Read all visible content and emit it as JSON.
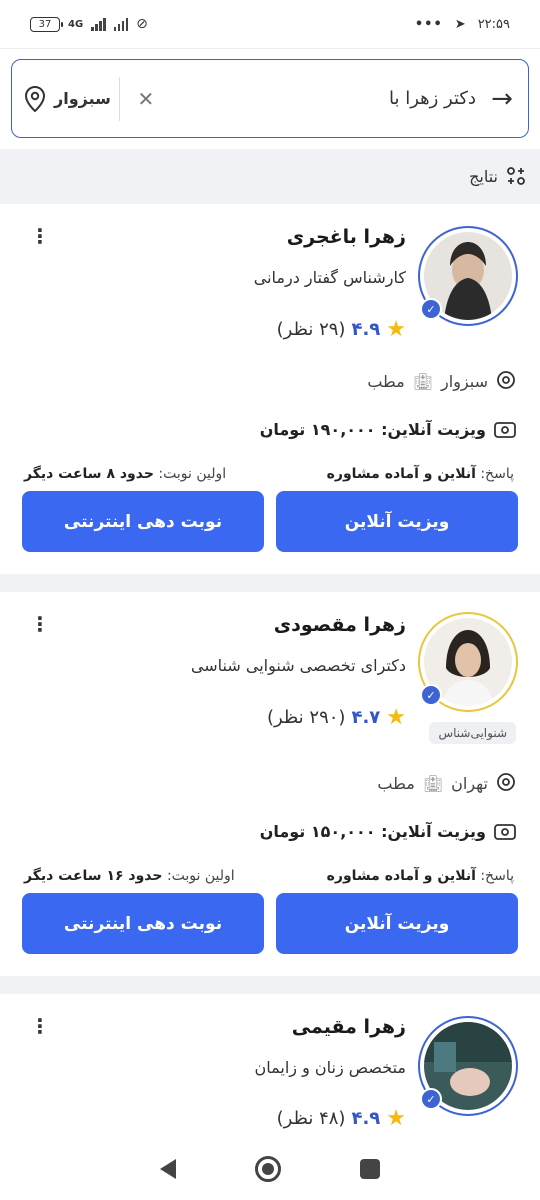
{
  "status": {
    "battery": "37",
    "network": "4G",
    "time": "۲۲:۵۹",
    "dots": "•••"
  },
  "search": {
    "query": "دکتر زهرا با",
    "city": "سبزوار"
  },
  "results": {
    "title": "نتایج"
  },
  "doctors": [
    {
      "name": "زهرا باغجری",
      "specialty": "کارشناس گفتار درمانی",
      "score": "۴.۹",
      "count": "(۲۹ نظر)",
      "tag": "",
      "city": "سبزوار",
      "office": "مطب",
      "visit": "ویزیت آنلاین: ۱۹۰,۰۰۰ تومان",
      "response_label": "پاسخ:",
      "response_value": "آنلاین و آماده مشاوره",
      "first_label": "اولین نوبت:",
      "first_value": "حدود ۸ ساعت دیگر",
      "btn_online": "ویزیت آنلاین",
      "btn_book": "نوبت دهی اینترنتی"
    },
    {
      "name": "زهرا مقصودی",
      "specialty": "دکترای تخصصی شنوایی شناسی",
      "score": "۴.۷",
      "count": "(۲۹۰ نظر)",
      "tag": "شنوایی‌شناس",
      "city": "تهران",
      "office": "مطب",
      "visit": "ویزیت آنلاین: ۱۵۰,۰۰۰ تومان",
      "response_label": "پاسخ:",
      "response_value": "آنلاین و آماده مشاوره",
      "first_label": "اولین نوبت:",
      "first_value": "حدود ۱۶ ساعت دیگر",
      "btn_online": "ویزیت آنلاین",
      "btn_book": "نوبت دهی اینترنتی"
    },
    {
      "name": "زهرا مقیمی",
      "specialty": "متخصص زنان و زایمان",
      "score": "۴.۹",
      "count": "(۴۸ نظر)"
    }
  ],
  "colors": {
    "accent": "#3b68f0",
    "star": "#f6b90c",
    "verified": "#3e63d3"
  }
}
